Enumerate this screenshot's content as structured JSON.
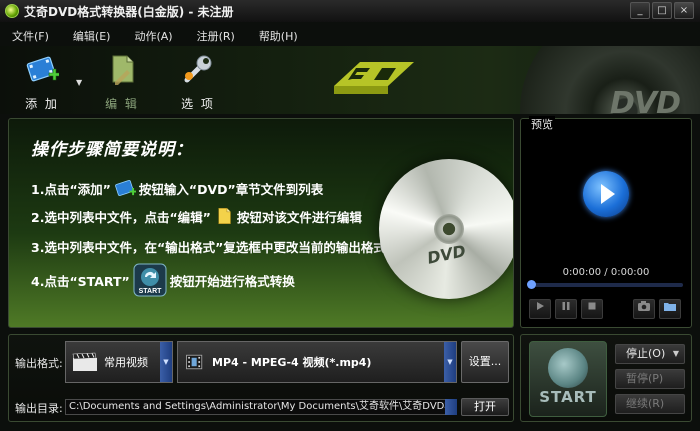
{
  "window": {
    "title": "艾奇DVD格式转换器(白金版) - 未注册",
    "controls": [
      "_",
      "□",
      "×"
    ]
  },
  "menu": [
    "文件(F)",
    "编辑(E)",
    "动作(A)",
    "注册(R)",
    "帮助(H)"
  ],
  "toolbar": {
    "add_label": "添 加",
    "add_dropdown": "▼",
    "edit_label": "编 辑",
    "options_label": "选 项",
    "deco_text": "DVD",
    "icons": {
      "add": "film-plus-icon",
      "edit": "edit-document-icon",
      "options": "wrench-icon"
    }
  },
  "instructions": {
    "title": "操作步骤简要说明：",
    "steps": [
      {
        "before": "1.点击“添加”",
        "after": "按钮输入“DVD”章节文件到列表"
      },
      {
        "before": "2.选中列表中文件，点击“编辑”",
        "after": "按钮对该文件进行编辑"
      },
      {
        "before": "3.选中列表中文件，在“输出格式”复选框中更改当前的输出格式",
        "after": ""
      },
      {
        "before": "4.点击“START”",
        "after": "按钮开始进行格式转换"
      }
    ],
    "start_icon_text": "START",
    "disc_label": "DVD"
  },
  "preview": {
    "label": "预览",
    "time": "0:00:00 / 0:00:00",
    "progress": 0
  },
  "output": {
    "format_label": "输出格式:",
    "category": "常用视频",
    "format": "MP4 - MPEG-4 视频(*.mp4)",
    "settings_button": "设置...",
    "dir_label": "输出目录:",
    "dir_value": "C:\\Documents and Settings\\Administrator\\My Documents\\艾奇软件\\艾奇DVD格式转换器",
    "open_button": "打开"
  },
  "actions": {
    "start": "START",
    "stop": "停止(O)",
    "pause": "暂停(P)",
    "resume": "继续(R)"
  },
  "colors": {
    "accent_green": "#4f7a26",
    "play_blue": "#1b6fd8"
  }
}
